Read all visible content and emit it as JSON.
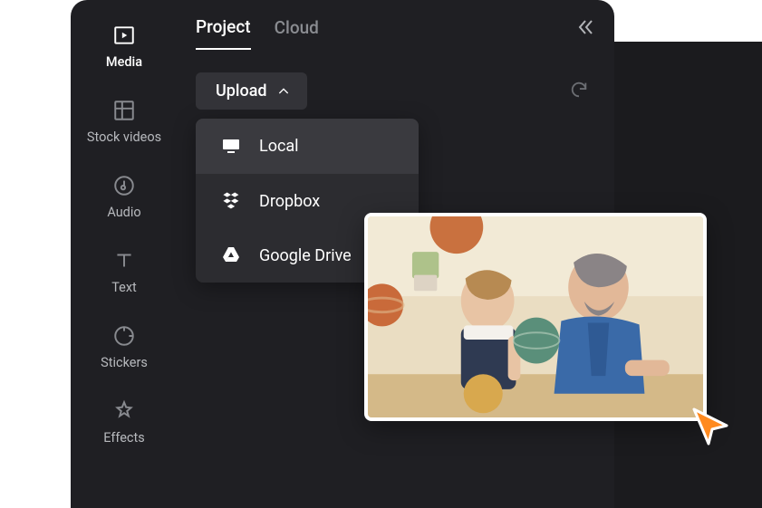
{
  "sidebar": {
    "items": [
      {
        "label": "Media"
      },
      {
        "label": "Stock videos"
      },
      {
        "label": "Audio"
      },
      {
        "label": "Text"
      },
      {
        "label": "Stickers"
      },
      {
        "label": "Effects"
      }
    ],
    "active_index": 0
  },
  "tabs": {
    "items": [
      {
        "label": "Project"
      },
      {
        "label": "Cloud"
      }
    ],
    "active_index": 0
  },
  "upload": {
    "button_label": "Upload",
    "options": [
      {
        "label": "Local"
      },
      {
        "label": "Dropbox"
      },
      {
        "label": "Google Drive"
      }
    ],
    "hover_index": 0
  }
}
